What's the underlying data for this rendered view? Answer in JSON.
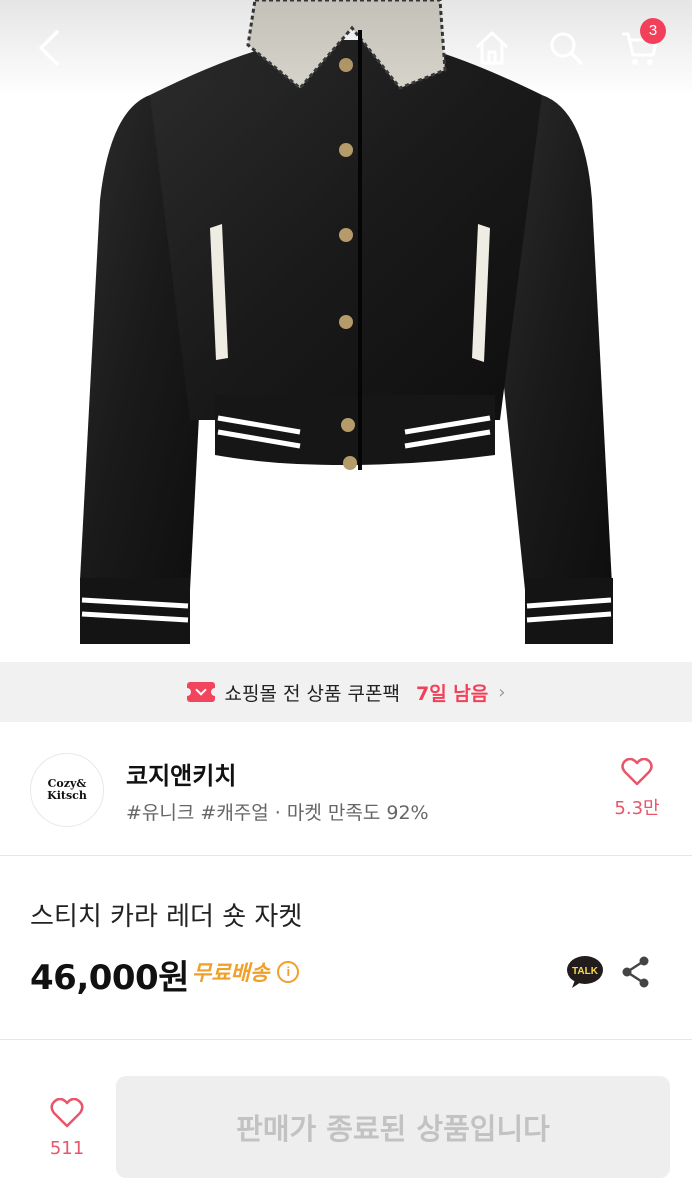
{
  "header": {
    "back_icon": "chevron-left-icon",
    "home_icon": "home-icon",
    "search_icon": "search-icon",
    "cart_icon": "cart-icon",
    "cart_badge": "3"
  },
  "coupon_banner": {
    "text": "쇼핑몰 전 상품 쿠폰팩",
    "days": "7일 남음",
    "chevron": "›",
    "icon": "coupon-ticket-icon",
    "color": "#f2405a"
  },
  "store": {
    "logo_line1": "Cozy&",
    "logo_line2": "Kitsch",
    "name": "코지앤키치",
    "tags": "#유니크 #캐주얼 · 마켓 만족도 92%",
    "like_icon": "heart-icon",
    "like_count": "5.3만"
  },
  "product": {
    "title": "스티치 카라 레더 숏 자켓",
    "price": "46,000원",
    "shipping": "무료배송",
    "shipping_color": "#f0a028",
    "info_glyph": "i",
    "talk_label": "TALK",
    "share_icon": "share-icon"
  },
  "bottom_bar": {
    "like_icon": "heart-icon",
    "like_count": "511",
    "status_button": "판매가 종료된 상품입니다"
  }
}
